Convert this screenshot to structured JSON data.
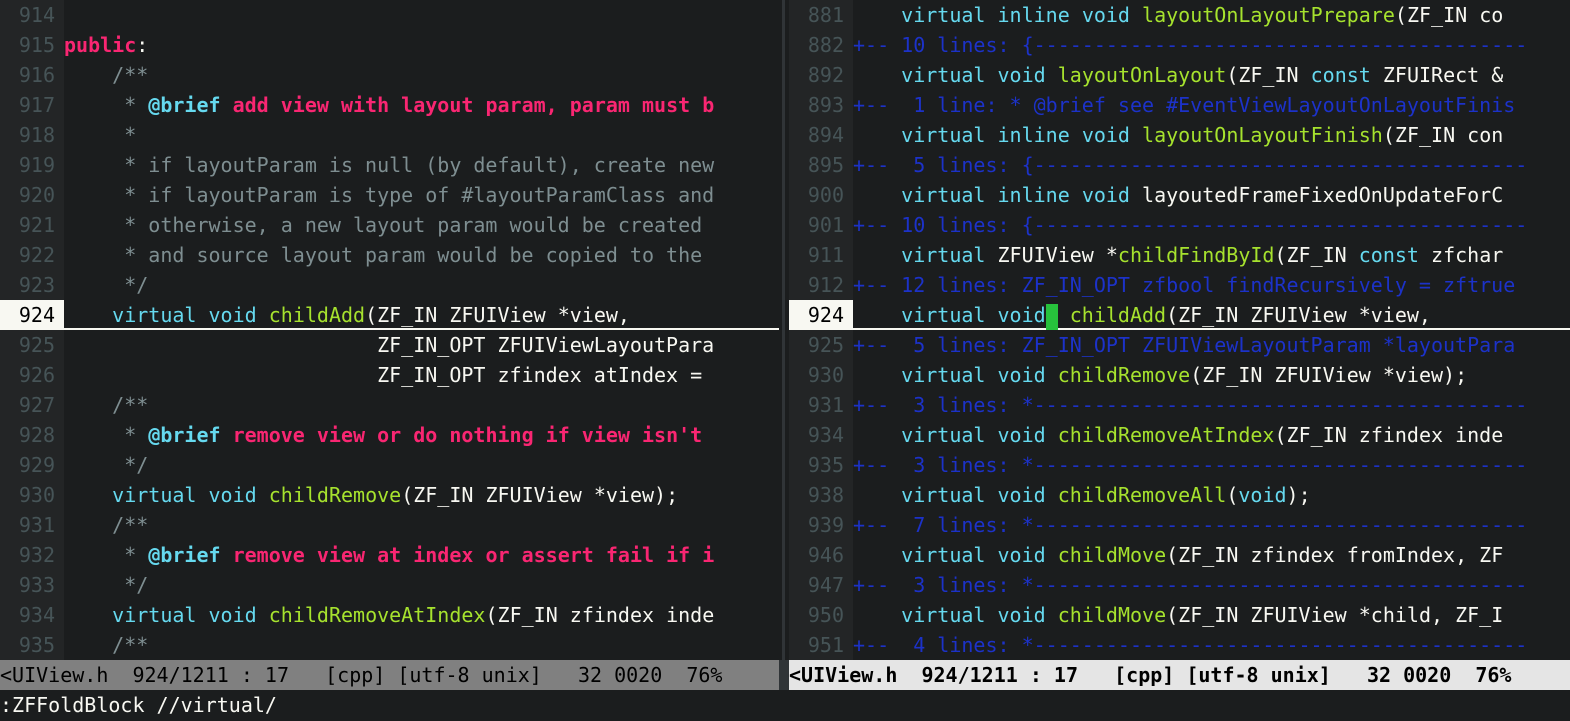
{
  "colors": {
    "background": "#1b1d1e",
    "keyword": "#66d9ef",
    "function": "#a6e22e",
    "string_pink": "#f92672",
    "comment": "#7e8e91",
    "fold_text": "#1c32c9",
    "cursor": "#27c23c"
  },
  "left_pane": {
    "lines": [
      {
        "num": "914",
        "text": ""
      },
      {
        "num": "915",
        "text": "public:"
      },
      {
        "num": "916",
        "text": "    /**"
      },
      {
        "num": "917",
        "text": "     * @brief add view with layout param, param must b"
      },
      {
        "num": "918",
        "text": "     *"
      },
      {
        "num": "919",
        "text": "     * if layoutParam is null (by default), create new"
      },
      {
        "num": "920",
        "text": "     * if layoutParam is type of #layoutParamClass and"
      },
      {
        "num": "921",
        "text": "     * otherwise, a new layout param would be created"
      },
      {
        "num": "922",
        "text": "     * and source layout param would be copied to the"
      },
      {
        "num": "923",
        "text": "     */"
      },
      {
        "num": "924",
        "text": "    virtual void childAdd(ZF_IN ZFUIView *view,"
      },
      {
        "num": "925",
        "text": "                          ZF_IN_OPT ZFUIViewLayoutPara"
      },
      {
        "num": "926",
        "text": "                          ZF_IN_OPT zfindex atIndex ="
      },
      {
        "num": "927",
        "text": "    /**"
      },
      {
        "num": "928",
        "text": "     * @brief remove view or do nothing if view isn't"
      },
      {
        "num": "929",
        "text": "     */"
      },
      {
        "num": "930",
        "text": "    virtual void childRemove(ZF_IN ZFUIView *view);"
      },
      {
        "num": "931",
        "text": "    /**"
      },
      {
        "num": "932",
        "text": "     * @brief remove view at index or assert fail if i"
      },
      {
        "num": "933",
        "text": "     */"
      },
      {
        "num": "934",
        "text": "    virtual void childRemoveAtIndex(ZF_IN zfindex inde"
      },
      {
        "num": "935",
        "text": "    /**"
      }
    ]
  },
  "right_pane": {
    "lines": [
      {
        "num": "881",
        "text": "    virtual inline void layoutOnLayoutPrepare(ZF_IN co"
      },
      {
        "num": "882",
        "text": "+-- 10 lines: {-----------------------------------------"
      },
      {
        "num": "892",
        "text": "    virtual void layoutOnLayout(ZF_IN const ZFUIRect &"
      },
      {
        "num": "893",
        "text": "+--  1 line: * @brief see #EventViewLayoutOnLayoutFinis"
      },
      {
        "num": "894",
        "text": "    virtual inline void layoutOnLayoutFinish(ZF_IN con"
      },
      {
        "num": "895",
        "text": "+--  5 lines: {-----------------------------------------"
      },
      {
        "num": "900",
        "text": "    virtual inline void layoutedFrameFixedOnUpdateForC"
      },
      {
        "num": "901",
        "text": "+-- 10 lines: {-----------------------------------------"
      },
      {
        "num": "911",
        "text": "    virtual ZFUIView *childFindById(ZF_IN const zfchar"
      },
      {
        "num": "912",
        "text": "+-- 12 lines: ZF_IN_OPT zfbool findRecursively = zftrue"
      },
      {
        "num": "924",
        "text": "    virtual void childAdd(ZF_IN ZFUIView *view,"
      },
      {
        "num": "925",
        "text": "+--  5 lines: ZF_IN_OPT ZFUIViewLayoutParam *layoutPara"
      },
      {
        "num": "930",
        "text": "    virtual void childRemove(ZF_IN ZFUIView *view);"
      },
      {
        "num": "931",
        "text": "+--  3 lines: *-----------------------------------------"
      },
      {
        "num": "934",
        "text": "    virtual void childRemoveAtIndex(ZF_IN zfindex inde"
      },
      {
        "num": "935",
        "text": "+--  3 lines: *-----------------------------------------"
      },
      {
        "num": "938",
        "text": "    virtual void childRemoveAll(void);"
      },
      {
        "num": "939",
        "text": "+--  7 lines: *-----------------------------------------"
      },
      {
        "num": "946",
        "text": "    virtual void childMove(ZF_IN zfindex fromIndex, ZF"
      },
      {
        "num": "947",
        "text": "+--  3 lines: *-----------------------------------------"
      },
      {
        "num": "950",
        "text": "    virtual void childMove(ZF_IN ZFUIView *child, ZF_I"
      },
      {
        "num": "951",
        "text": "+--  4 lines: *-----------------------------------------"
      }
    ]
  },
  "status_left": "<UIView.h  924/1211 : 17   [cpp] [utf-8 unix]   32 0020  76%",
  "status_right": "<UIView.h  924/1211 : 17   [cpp] [utf-8 unix]   32 0020  76%",
  "cmdline": ":ZFFoldBlock //virtual/"
}
